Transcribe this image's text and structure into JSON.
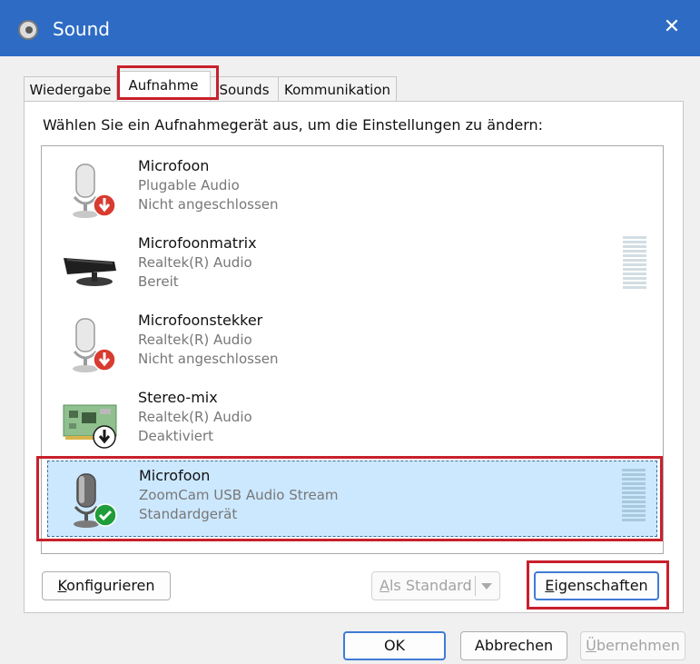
{
  "window": {
    "title": "Sound",
    "close_glyph": "✕"
  },
  "tabs": [
    {
      "label": "Wiedergabe"
    },
    {
      "label": "Aufnahme"
    },
    {
      "label": "Sounds"
    },
    {
      "label": "Kommunikation"
    }
  ],
  "active_tab": "Aufnahme",
  "instruction": "Wählen Sie ein Aufnahmegerät aus, um die Einstellungen zu ändern:",
  "devices": [
    {
      "name": "Microfoon",
      "driver": "Plugable Audio",
      "status": "Nicht angeschlossen",
      "icon": "microphone-icon",
      "badge": "unplugged-badge-icon"
    },
    {
      "name": "Microfoonmatrix",
      "driver": "Realtek(R) Audio",
      "status": "Bereit",
      "icon": "microphone-array-icon",
      "badge": "none"
    },
    {
      "name": "Microfoonstekker",
      "driver": "Realtek(R) Audio",
      "status": "Nicht angeschlossen",
      "icon": "microphone-icon",
      "badge": "unplugged-badge-icon"
    },
    {
      "name": "Stereo-mix",
      "driver": "Realtek(R) Audio",
      "status": "Deaktiviert",
      "icon": "sound-card-icon",
      "badge": "disabled-badge-icon"
    },
    {
      "name": "Microfoon",
      "driver": "ZoomCam USB Audio Stream",
      "status": "Standardgerät",
      "icon": "microphone-icon",
      "badge": "default-check-badge-icon",
      "selected": true
    }
  ],
  "buttons": {
    "configure": {
      "prefix": "K",
      "rest": "onfigurieren"
    },
    "set_default": {
      "prefix": "A",
      "rest": "ls Standard",
      "disabled": true
    },
    "properties": {
      "prefix": "E",
      "rest": "igenschaften"
    },
    "ok": "OK",
    "cancel": "Abbrechen",
    "apply": {
      "prefix": "Ü",
      "rest": "bernehmen",
      "disabled": true
    }
  },
  "colors": {
    "titlebar": "#2d6bc4",
    "highlight_red": "#c8202c",
    "selection": "#cce8ff",
    "badge_red": "#d83b2f",
    "badge_green": "#1f9d3a"
  }
}
